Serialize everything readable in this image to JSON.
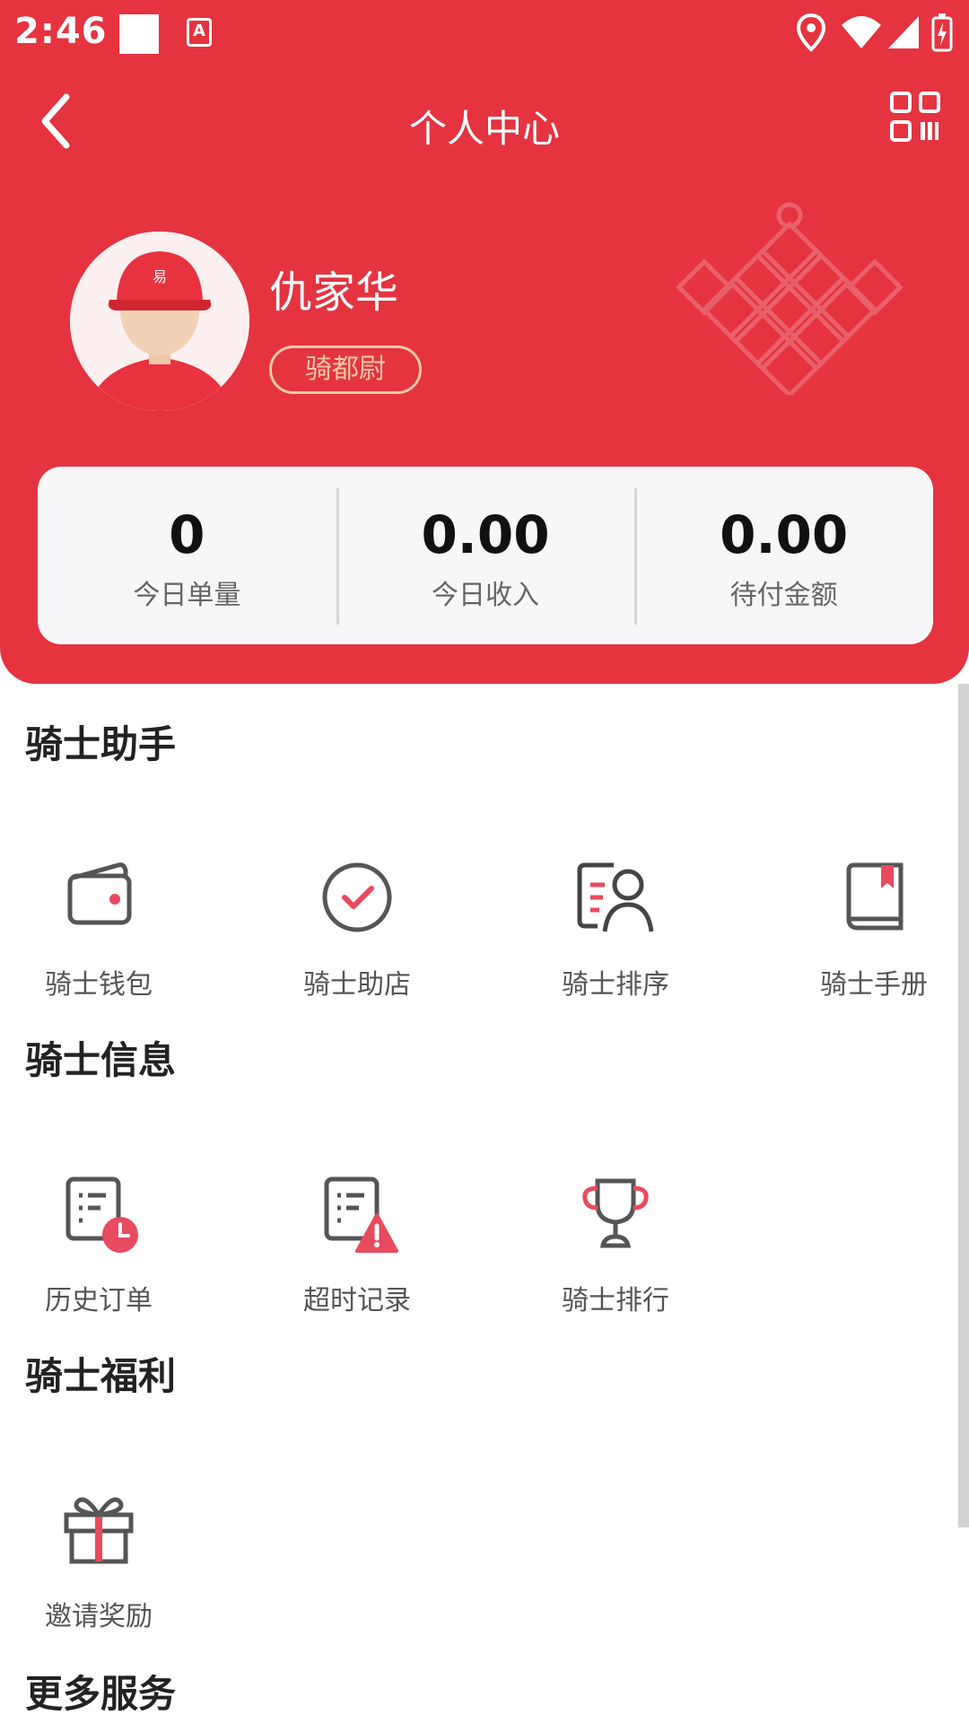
{
  "status_bar": {
    "time": "2:46",
    "a_icon_text": "A"
  },
  "topbar": {
    "title": "个人中心"
  },
  "profile": {
    "name": "仇家华",
    "level": "骑都尉"
  },
  "stats": [
    {
      "value": "0",
      "label": "今日单量"
    },
    {
      "value": "0.00",
      "label": "今日收入"
    },
    {
      "value": "0.00",
      "label": "待付金额"
    }
  ],
  "sections": {
    "assistant": {
      "title": "骑士助手",
      "items": [
        {
          "label": "骑士钱包",
          "icon": "wallet-icon"
        },
        {
          "label": "骑士助店",
          "icon": "check-circle-icon"
        },
        {
          "label": "骑士排序",
          "icon": "rider-sort-icon"
        },
        {
          "label": "骑士手册",
          "icon": "book-icon"
        }
      ]
    },
    "info": {
      "title": "骑士信息",
      "items": [
        {
          "label": "历史订单",
          "icon": "history-order-icon"
        },
        {
          "label": "超时记录",
          "icon": "timeout-record-icon"
        },
        {
          "label": "骑士排行",
          "icon": "trophy-icon"
        }
      ]
    },
    "welfare": {
      "title": "骑士福利",
      "items": [
        {
          "label": "邀请奖励",
          "icon": "gift-icon"
        }
      ]
    },
    "more": {
      "title": "更多服务"
    }
  },
  "colors": {
    "brand": "#e53340",
    "badge": "#f6c9a3",
    "accent": "#e84a5f"
  }
}
